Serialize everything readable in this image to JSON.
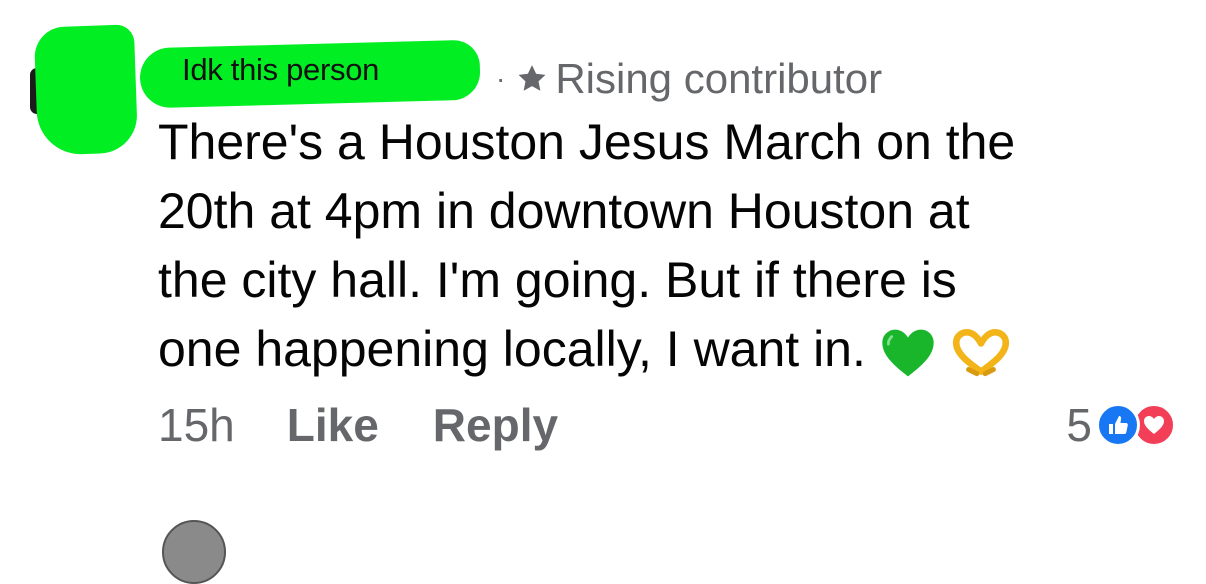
{
  "comment": {
    "author_redaction_label": "Idk this person",
    "separator": "·",
    "badge_label": "Rising contributor",
    "badge_icon": "star-icon",
    "text_lines": [
      "There's a Houston Jesus March on the",
      "20th at 4pm in downtown Houston at",
      "the city hall. I'm going. But if there is",
      "one happening locally, I want in."
    ],
    "emojis": [
      "green-heart-emoji",
      "heart-hands-emoji"
    ],
    "timestamp": "15h",
    "like_label": "Like",
    "reply_label": "Reply",
    "reaction_count": "5",
    "reaction_icons": [
      "like-icon",
      "love-icon"
    ]
  },
  "colors": {
    "redaction_green": "#00ee22",
    "meta_gray": "#65676b",
    "like_blue": "#1877f2",
    "love_red": "#f33e58"
  }
}
